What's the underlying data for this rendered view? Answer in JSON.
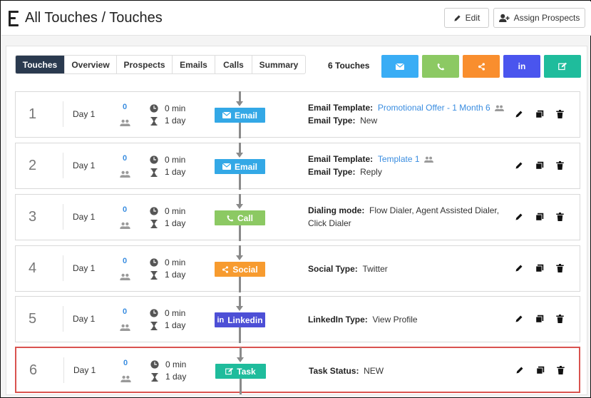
{
  "header": {
    "title": "All Touches / Touches",
    "edit_label": "Edit",
    "assign_label": "Assign Prospects"
  },
  "tabs": [
    {
      "label": "Touches",
      "active": true
    },
    {
      "label": "Overview",
      "active": false
    },
    {
      "label": "Prospects",
      "active": false
    },
    {
      "label": "Emails",
      "active": false
    },
    {
      "label": "Calls",
      "active": false
    },
    {
      "label": "Summary",
      "active": false
    }
  ],
  "touch_count": "6 Touches",
  "add_buttons": [
    {
      "type": "email",
      "icon": "envelope-icon",
      "color": "#39adf5"
    },
    {
      "type": "call",
      "icon": "phone-icon",
      "color": "#8cc963"
    },
    {
      "type": "social",
      "icon": "share-icon",
      "color": "#f98e2e"
    },
    {
      "type": "linkedin",
      "icon": "linkedin-icon",
      "color": "#4a55ee"
    },
    {
      "type": "task",
      "icon": "edit-icon",
      "color": "#1fbc9c"
    }
  ],
  "colors": {
    "email": "#33a8e6",
    "call": "#8cc963",
    "social": "#f79b2f",
    "linkedin": "#4d4fd6",
    "task": "#1fbc9c",
    "selected_border": "#d9534f",
    "tab_active": "#2a3a4f"
  },
  "touches": [
    {
      "num": "1",
      "day": "Day 1",
      "count": "0",
      "minutes": "0 min",
      "duration": "1 day",
      "badge": "Email",
      "type": "email",
      "line1_label": "Email Template:",
      "line1_value": "Promotional Offer - 1 Month 6",
      "line1_link": true,
      "line2_label": "Email Type:",
      "line2_value": "New"
    },
    {
      "num": "2",
      "day": "Day 1",
      "count": "0",
      "minutes": "0 min",
      "duration": "1 day",
      "badge": "Email",
      "type": "email",
      "line1_label": "Email Template:",
      "line1_value": "Template 1",
      "line1_link": true,
      "line2_label": "Email Type:",
      "line2_value": "Reply"
    },
    {
      "num": "3",
      "day": "Day 1",
      "count": "0",
      "minutes": "0 min",
      "duration": "1 day",
      "badge": "Call",
      "type": "call",
      "line1_label": "Dialing mode:",
      "line1_value": "Flow Dialer, Agent Assisted Dialer,",
      "line1_link": false,
      "line2_label": "",
      "line2_value": "Click Dialer"
    },
    {
      "num": "4",
      "day": "Day 1",
      "count": "0",
      "minutes": "0 min",
      "duration": "1 day",
      "badge": "Social",
      "type": "social",
      "line1_label": "Social Type:",
      "line1_value": "Twitter",
      "line1_link": false
    },
    {
      "num": "5",
      "day": "Day 1",
      "count": "0",
      "minutes": "0 min",
      "duration": "1 day",
      "badge": "Linkedin",
      "type": "linkedin",
      "line1_label": "LinkedIn Type:",
      "line1_value": "View Profile",
      "line1_link": false
    },
    {
      "num": "6",
      "day": "Day 1",
      "count": "0",
      "minutes": "0 min",
      "duration": "1 day",
      "badge": "Task",
      "type": "task",
      "line1_label": "Task Status:",
      "line1_value": "NEW",
      "line1_link": false,
      "selected": true
    }
  ]
}
